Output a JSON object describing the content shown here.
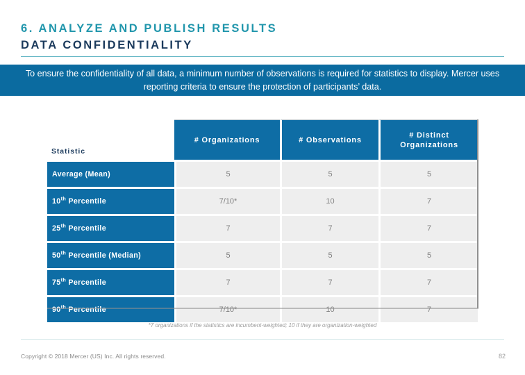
{
  "slide": {
    "title_line_1": "6. ANALYZE AND PUBLISH RESULTS",
    "title_line_2": "DATA CONFIDENTIALITY",
    "banner_text": "To ensure the confidentiality of all data, a minimum number of observations is required for statistics to display. Mercer uses reporting criteria to ensure the protection of participants’ data."
  },
  "table": {
    "headers": {
      "statistic": "Statistic",
      "organizations": "# Organizations",
      "observations": "# Observations",
      "distinct_organizations_line1": "# Distinct",
      "distinct_organizations_line2": "Organizations"
    },
    "rows": [
      {
        "label": "Average (Mean)",
        "label_sup": "",
        "label_tail": "",
        "organizations": "5",
        "observations": "5",
        "distinct_organizations": "5"
      },
      {
        "label": "10",
        "label_sup": "th",
        "label_tail": " Percentile",
        "organizations": "7/10*",
        "observations": "10",
        "distinct_organizations": "7"
      },
      {
        "label": "25",
        "label_sup": "th",
        "label_tail": " Percentile",
        "organizations": "7",
        "observations": "7",
        "distinct_organizations": "7"
      },
      {
        "label": "50",
        "label_sup": "th",
        "label_tail": " Percentile (Median)",
        "organizations": "5",
        "observations": "5",
        "distinct_organizations": "5"
      },
      {
        "label": "75",
        "label_sup": "th",
        "label_tail": " Percentile",
        "organizations": "7",
        "observations": "7",
        "distinct_organizations": "7"
      },
      {
        "label": "90",
        "label_sup": "th",
        "label_tail": " Percentile",
        "organizations": "7/10*",
        "observations": "10",
        "distinct_organizations": "7"
      }
    ]
  },
  "footnote": "*7 organizations if the statistics are incumbent-weighted; 10 if they are organization-weighted",
  "footer": {
    "copyright": "Copyright © 2018 Mercer (US) Inc. All rights reserved.",
    "page_number": "82"
  },
  "colors": {
    "accent_teal": "#2196ac",
    "title_navy": "#1b3a5c",
    "banner_blue": "#0b6ba0",
    "table_blue": "#0e6da5",
    "cell_gray": "#eeeeee",
    "value_gray": "#808080"
  }
}
